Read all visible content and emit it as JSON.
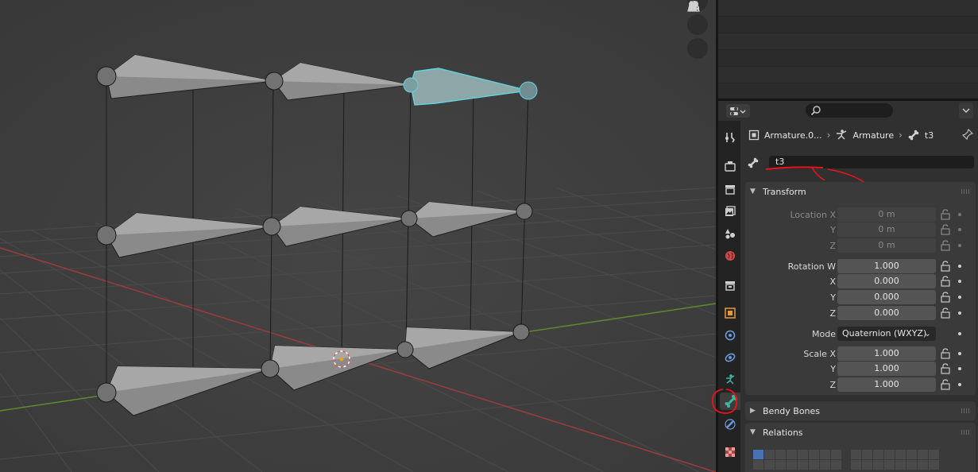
{
  "breadcrumb": {
    "object_name": "Armature.0...",
    "armature_name": "Armature",
    "bone_name": "t3"
  },
  "bone": {
    "name_value": "t3"
  },
  "transform": {
    "title": "Transform",
    "location": {
      "label_x": "Location X",
      "label_y": "Y",
      "label_z": "Z",
      "x": "0 m",
      "y": "0 m",
      "z": "0 m"
    },
    "rotation": {
      "label_w": "Rotation W",
      "label_x": "X",
      "label_y": "Y",
      "label_z": "Z",
      "w": "1.000",
      "x": "0.000",
      "y": "0.000",
      "z": "0.000"
    },
    "mode": {
      "label": "Mode",
      "value": "Quaternion (WXYZ)"
    },
    "scale": {
      "label_x": "Scale X",
      "label_y": "Y",
      "label_z": "Z",
      "x": "1.000",
      "y": "1.000",
      "z": "1.000"
    }
  },
  "panels": {
    "bendy_bones": "Bendy Bones",
    "relations": "Relations"
  },
  "property_tabs": [
    "tool-tab",
    "render-tab",
    "output-tab",
    "view-layer-tab",
    "scene-tab",
    "world-tab",
    "collection-tab",
    "object-tab",
    "modifiers-tab",
    "physics-tab",
    "object-data-armature-tab",
    "bone-tab",
    "bone-constraints-tab",
    "texture-tab"
  ],
  "active_tab": "bone-tab",
  "colors": {
    "accent_blue": "#4772b3",
    "selected_bone": "#63d4e0",
    "annotation_red": "#e8141c",
    "x_axis": "#b54747",
    "y_axis": "#6a9a35"
  },
  "icons": {
    "viewport_hand": "hand-icon",
    "viewport_camera": "camera-icon",
    "viewport_ortho": "grid-perspective-icon",
    "search": "search-icon",
    "pin": "pin-icon"
  }
}
